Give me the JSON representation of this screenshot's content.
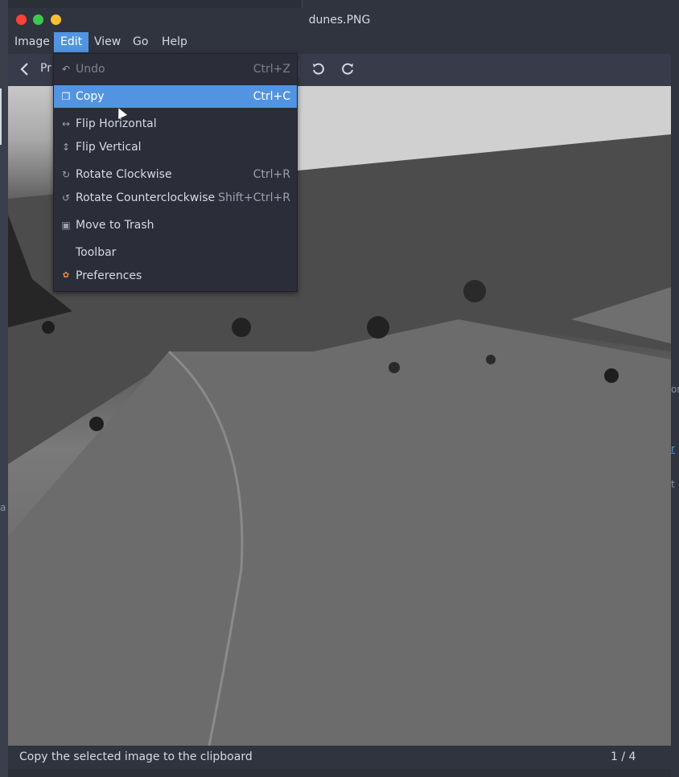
{
  "window": {
    "title": "dunes.PNG"
  },
  "menubar": {
    "items": [
      {
        "label": "Image"
      },
      {
        "label": "Edit"
      },
      {
        "label": "View"
      },
      {
        "label": "Go"
      },
      {
        "label": "Help"
      }
    ]
  },
  "toolbar": {
    "prev_label": "Pr",
    "icons": [
      "back-arrow-icon",
      "rotate-counterclockwise-icon",
      "rotate-clockwise-icon"
    ]
  },
  "edit_menu": {
    "items": [
      {
        "label": "Undo",
        "accel": "Ctrl+Z",
        "icon": "undo-icon",
        "state": "disabled"
      },
      {
        "label": "Copy",
        "accel": "Ctrl+C",
        "icon": "copy-icon",
        "state": "selected"
      },
      {
        "label": "Flip Horizontal",
        "accel": "",
        "icon": "flip-horizontal-icon",
        "state": "normal"
      },
      {
        "label": "Flip Vertical",
        "accel": "",
        "icon": "flip-vertical-icon",
        "state": "normal"
      },
      {
        "label": "Rotate Clockwise",
        "accel": "Ctrl+R",
        "icon": "rotate-clockwise-icon",
        "state": "normal"
      },
      {
        "label": "Rotate Counterclockwise",
        "accel": "Shift+Ctrl+R",
        "icon": "rotate-counterclockwise-icon",
        "state": "normal"
      },
      {
        "label": "Move to Trash",
        "accel": "",
        "icon": "trash-icon",
        "state": "normal"
      },
      {
        "label": "Toolbar",
        "accel": "",
        "icon": "",
        "state": "normal"
      },
      {
        "label": "Preferences",
        "accel": "",
        "icon": "preferences-icon",
        "state": "normal"
      }
    ]
  },
  "statusbar": {
    "message": "Copy the selected image to the clipboard",
    "position": "1 / 4"
  },
  "background_fragments": [
    "or",
    "r",
    "t",
    "a"
  ],
  "colors": {
    "accent": "#5294e2",
    "titlebar": "#2f343f",
    "window": "#383c4a",
    "menu": "#2b2e39",
    "close": "#fc4138",
    "maximize": "#3bca4c",
    "minimize": "#fdbe2f"
  }
}
